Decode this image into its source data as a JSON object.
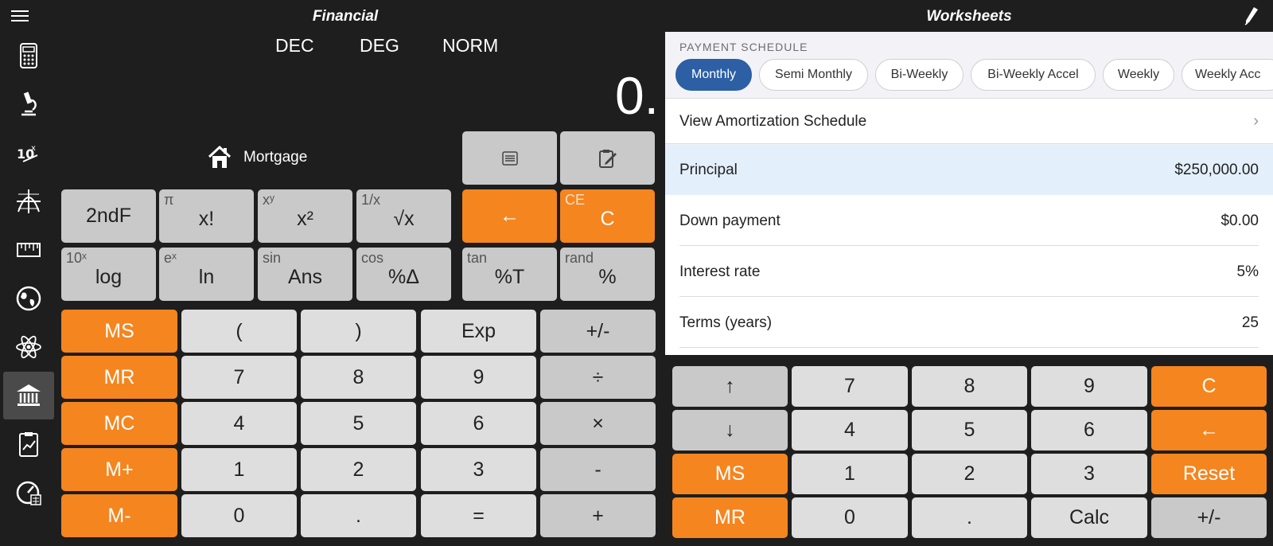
{
  "header": {
    "left_title": "Financial",
    "right_title": "Worksheets"
  },
  "sidebar": {
    "items": [
      {
        "icon": "calculator-icon"
      },
      {
        "icon": "microscope-icon"
      },
      {
        "icon": "exponent-icon"
      },
      {
        "icon": "graph-icon"
      },
      {
        "icon": "ruler-icon"
      },
      {
        "icon": "globe-icon"
      },
      {
        "icon": "atom-icon"
      },
      {
        "icon": "bank-icon",
        "active": true
      },
      {
        "icon": "clipboard-chart-icon"
      },
      {
        "icon": "speedometer-icon"
      }
    ]
  },
  "calc": {
    "modes": {
      "base": "DEC",
      "angle": "DEG",
      "notation": "NORM"
    },
    "display": "0.",
    "mortgage_label": "Mortgage",
    "func_row1": [
      {
        "main": "2ndF",
        "sup": ""
      },
      {
        "main": "x!",
        "sup": "π"
      },
      {
        "main": "x²",
        "sup": "xʸ"
      },
      {
        "main": "√x",
        "sup": "1/x"
      },
      {
        "main": "←",
        "sup": ""
      },
      {
        "main": "C",
        "sup": "CE"
      }
    ],
    "func_row2": [
      {
        "main": "log",
        "sup": "10ˣ"
      },
      {
        "main": "ln",
        "sup": "eˣ"
      },
      {
        "main": "Ans",
        "sup": "sin"
      },
      {
        "main": "%Δ",
        "sup": "cos"
      },
      {
        "main": "%T",
        "sup": "tan"
      },
      {
        "main": "%",
        "sup": "rand"
      }
    ],
    "memory": [
      "MS",
      "MR",
      "MC",
      "M+",
      "M-"
    ],
    "grid": [
      [
        "(",
        ")",
        "Exp",
        "+/-"
      ],
      [
        "7",
        "8",
        "9",
        "÷"
      ],
      [
        "4",
        "5",
        "6",
        "×"
      ],
      [
        "1",
        "2",
        "3",
        "-"
      ],
      [
        "0",
        ".",
        "=",
        "+"
      ]
    ]
  },
  "worksheet": {
    "section_title": "PAYMENT SCHEDULE",
    "schedules": [
      "Monthly",
      "Semi Monthly",
      "Bi-Weekly",
      "Bi-Weekly Accel",
      "Weekly",
      "Weekly Acc"
    ],
    "selected_schedule": "Monthly",
    "amortization_link": "View Amortization Schedule",
    "fields": [
      {
        "label": "Principal",
        "value": "$250,000.00"
      },
      {
        "label": "Down payment",
        "value": "$0.00"
      },
      {
        "label": "Interest rate",
        "value": "5%"
      },
      {
        "label": "Terms (years)",
        "value": "25"
      }
    ]
  },
  "pad": {
    "rows": [
      [
        "↑",
        "7",
        "8",
        "9",
        "C"
      ],
      [
        "↓",
        "4",
        "5",
        "6",
        "←"
      ],
      [
        "MS",
        "1",
        "2",
        "3",
        "Reset"
      ],
      [
        "MR",
        "0",
        ".",
        "Calc",
        "+/-"
      ]
    ]
  },
  "colors": {
    "accent": "#f5851f",
    "link": "#2c5fa4",
    "highlight_row": "#e3f0fb"
  }
}
